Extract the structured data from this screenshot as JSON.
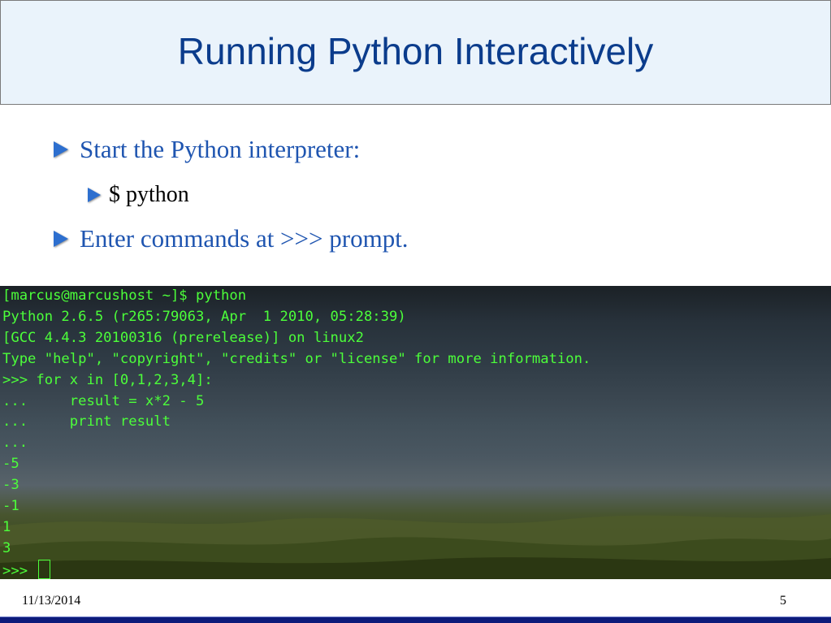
{
  "slide": {
    "title": "Running Python Interactively",
    "bullets": [
      {
        "level": 1,
        "text": "Start the Python interpreter:"
      },
      {
        "level": 2,
        "text": "$ python"
      },
      {
        "level": 1,
        "text": "Enter commands at >>> prompt."
      }
    ],
    "terminal_lines": [
      "[marcus@marcushost ~]$ python",
      "Python 2.6.5 (r265:79063, Apr  1 2010, 05:28:39)",
      "[GCC 4.4.3 20100316 (prerelease)] on linux2",
      "Type \"help\", \"copyright\", \"credits\" or \"license\" for more information.",
      ">>> for x in [0,1,2,3,4]:",
      "...     result = x*2 - 5",
      "...     print result",
      "...",
      "-5",
      "-3",
      "-1",
      "1",
      "3",
      ">>> "
    ],
    "footer": {
      "date": "11/13/2014",
      "page_number": "5"
    }
  },
  "icons": {
    "bullet": "triangle-bullet-icon",
    "cursor": "block-cursor-icon"
  },
  "colors": {
    "title_text": "#0b3c8c",
    "title_background": "#eaf3fb",
    "bullet_level1_text": "#1f55b0",
    "bullet_icon": "#2d6fcf",
    "terminal_text": "#4cff3a",
    "footer_bar": "#0d1b7a"
  }
}
